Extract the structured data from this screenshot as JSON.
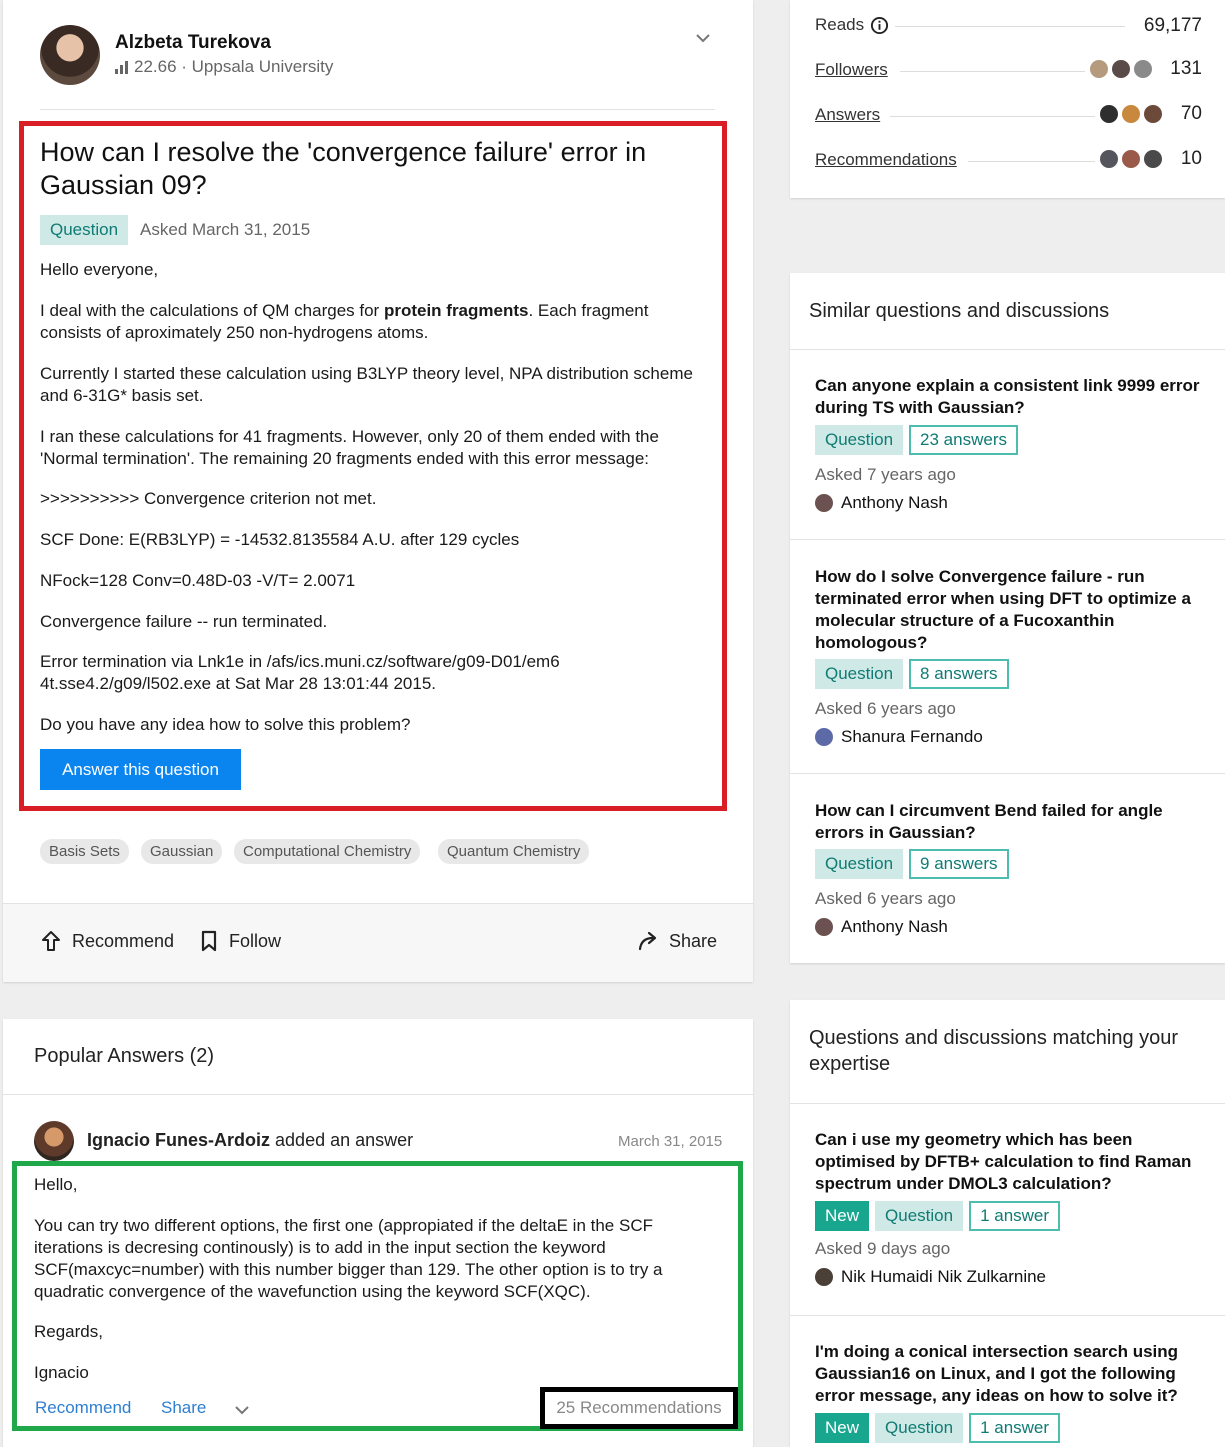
{
  "author": {
    "name": "Alzbeta Turekova",
    "score": "22.66",
    "institution": "Uppsala University",
    "score_line": "22.66 · Uppsala University"
  },
  "question": {
    "title": "How can I resolve the 'convergence failure' error in Gaussian 09?",
    "type_badge": "Question",
    "asked": "Asked March 31, 2015",
    "p1": "Hello everyone,",
    "p2_before": "I deal with the calculations of QM charges for ",
    "p2_bold": "protein fragments",
    "p2_after": ". Each fragment consists of aproximately 250 non-hydrogens atoms.",
    "p3": "Currently I started these calculation using B3LYP theory level, NPA distribution scheme and 6-31G* basis set.",
    "p4": "I ran these calculations for 41 fragments. However, only 20 of them ended with the 'Normal termination'. The remaining 20 fragments ended with this error message:",
    "p5": ">>>>>>>>>> Convergence criterion not met.",
    "p6": "SCF Done: E(RB3LYP) = -14532.8135584 A.U. after 129 cycles",
    "p7": "NFock=128 Conv=0.48D-03 -V/T= 2.0071",
    "p8": "Convergence failure -- run terminated.",
    "p9": "Error termination via Lnk1e in /afs/ics.muni.cz/software/g09-D01/em64t.sse4.2/g09/l502.exe at Sat Mar 28 13:01:44 2015.",
    "p10": "Do you have any idea how to solve this problem?",
    "answer_button": "Answer this question"
  },
  "topics": [
    "Basis Sets",
    "Gaussian",
    "Computational Chemistry",
    "Quantum Chemistry"
  ],
  "actions": {
    "recommend": "Recommend",
    "follow": "Follow",
    "share": "Share"
  },
  "stats": {
    "reads_label": "Reads",
    "reads_value": "69,177",
    "followers_label": "Followers",
    "followers_value": "131",
    "answers_label": "Answers",
    "answers_value": "70",
    "recommendations_label": "Recommendations",
    "recommendations_value": "10"
  },
  "popular": {
    "heading": "Popular Answers (2)",
    "answer": {
      "author": "Ignacio Funes-Ardoiz",
      "action": "added an answer",
      "date": "March 31, 2015",
      "p1": "Hello,",
      "p2": "You can try two different options, the first one (appropiated if the deltaE in the SCF iterations is decresing continously) is to add in the input section the keyword SCF(maxcyc=number) with this number bigger than 129. The other option is to try a quadratic convergence of the wavefunction using the keyword SCF(XQC).",
      "p3": "Regards,",
      "p4": "Ignacio",
      "recommend": "Recommend",
      "share": "Share",
      "recommendations": "25 Recommendations"
    }
  },
  "similar": {
    "heading": "Similar questions and discussions",
    "items": [
      {
        "title": "Can anyone explain a consistent link 9999 error during TS with Gaussian?",
        "badge": "Question",
        "answers": "23 answers",
        "asked": "Asked 7 years ago",
        "person": "Anthony Nash"
      },
      {
        "title": "How do I solve Convergence failure - run terminated error when using DFT to optimize a molecular structure of a Fucoxanthin homologous?",
        "badge": "Question",
        "answers": "8 answers",
        "asked": "Asked 6 years ago",
        "person": "Shanura Fernando"
      },
      {
        "title": "How can I circumvent Bend failed for angle errors in Gaussian?",
        "badge": "Question",
        "answers": "9 answers",
        "asked": "Asked 6 years ago",
        "person": "Anthony Nash"
      }
    ]
  },
  "expertise": {
    "heading": "Questions and discussions matching your expertise",
    "items": [
      {
        "title": "Can i use my geometry which has been optimised by DFTB+ calculation to find Raman spectrum under DMOL3 calculation?",
        "new": "New",
        "badge": "Question",
        "answers": "1 answer",
        "asked": "Asked 9 days ago",
        "person": "Nik Humaidi Nik Zulkarnine"
      },
      {
        "title": "I'm doing a conical intersection search using Gaussian16 on Linux, and I got the following error message, any ideas on how to solve it?",
        "new": "New",
        "badge": "Question",
        "answers": "1 answer"
      }
    ]
  },
  "colors": {
    "question_highlight": "#d91e25",
    "answer_highlight": "#1fa84a",
    "recommend_highlight": "#000000",
    "primary_button": "#0a84ef",
    "teal": "#0f7b74"
  }
}
